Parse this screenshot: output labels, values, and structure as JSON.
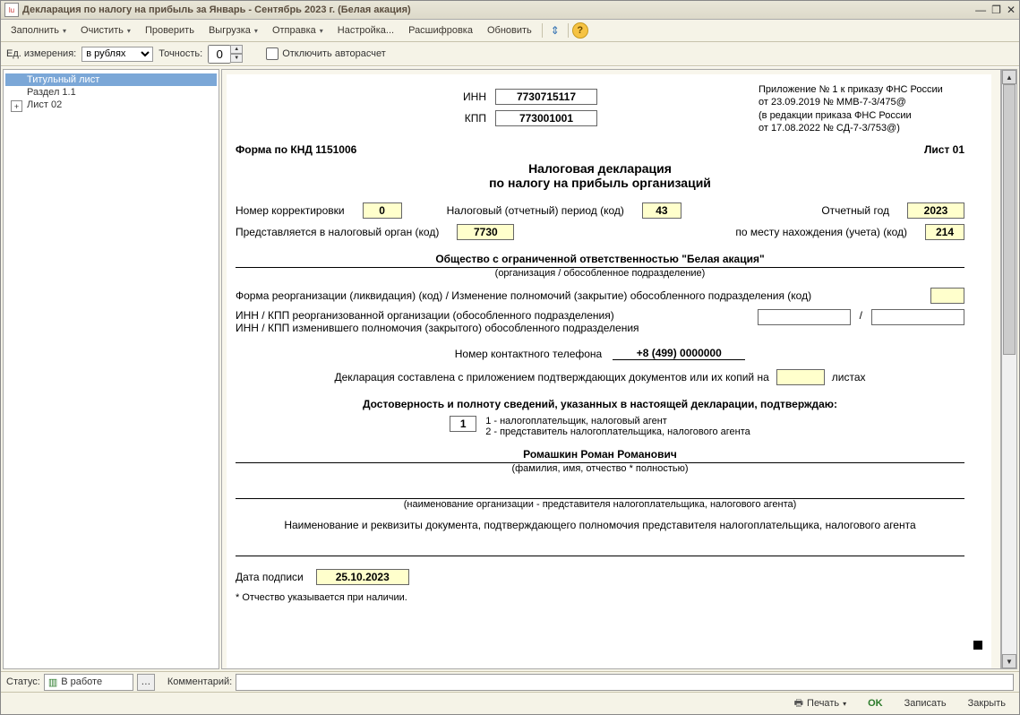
{
  "window": {
    "title": "Декларация по налогу на прибыль за Январь - Сентябрь 2023 г. (Белая акация)"
  },
  "toolbar": {
    "fill": "Заполнить",
    "clear": "Очистить",
    "check": "Проверить",
    "export": "Выгрузка",
    "send": "Отправка",
    "settings": "Настройка...",
    "decode": "Расшифровка",
    "refresh": "Обновить"
  },
  "sub": {
    "units_label": "Ед. измерения:",
    "units_value": "в рублях",
    "precision_label": "Точность:",
    "precision_value": "0",
    "autocalc": "Отключить авторасчет"
  },
  "tree": {
    "n0": "Титульный лист",
    "n1": "Раздел 1.1",
    "n2": "Лист 02"
  },
  "doc": {
    "inn_label": "ИНН",
    "inn": "7730715117",
    "kpp_label": "КПП",
    "kpp": "773001001",
    "appx1": "Приложение № 1 к приказу ФНС России",
    "appx2": "от 23.09.2019 № ММВ-7-3/475@",
    "appx3": "(в редакции приказа ФНС России",
    "appx4": "от 17.08.2022 № СД-7-3/753@)",
    "form_knd": "Форма по КНД 1151006",
    "sheet": "Лист 01",
    "title1": "Налоговая декларация",
    "title2": "по налогу на прибыль организаций",
    "corr_label": "Номер корректировки",
    "corr": "0",
    "period_label": "Налоговый (отчетный) период (код)",
    "period": "43",
    "year_label": "Отчетный год",
    "year": "2023",
    "organ_label": "Представляется в налоговый орган (код)",
    "organ": "7730",
    "place_label": "по месту нахождения (учета) (код)",
    "place": "214",
    "org_name": "Общество с ограниченной ответственностью \"Белая акация\"",
    "org_sub": "(организация / обособленное подразделение)",
    "reorg_label": "Форма реорганизации (ликвидация) (код) / Изменение полномочий (закрытие) обособленного подразделения (код)",
    "reorg_inn1": "ИНН / КПП реорганизованной организации (обособленного подразделения)",
    "reorg_inn2": "ИНН / КПП изменившего полномочия (закрытого) обособленного подразделения",
    "sep": "/",
    "phone_label": "Номер контактного телефона",
    "phone": "+8 (499) 0000000",
    "attach_label1": "Декларация составлена с приложением подтверждающих документов или их копий на",
    "attach_label2": "листах",
    "confirm_title": "Достоверность и полноту сведений, указанных в настоящей декларации, подтверждаю:",
    "confirm_code": "1",
    "confirm_opt1": "1 - налогоплательщик, налоговый агент",
    "confirm_opt2": "2 - представитель налогоплательщика, налогового агента",
    "fio": "Ромашкин Роман Романович",
    "fio_sub": "(фамилия, имя, отчество *  полностью)",
    "repr_sub": "(наименование организации - представителя налогоплательщика, налогового агента)",
    "doc_auth": "Наименование и реквизиты документа, подтверждающего полномочия представителя налогоплательщика, налогового агента",
    "sign_date_label": "Дата подписи",
    "sign_date": "25.10.2023",
    "note": "* Отчество указывается при наличии."
  },
  "status": {
    "label": "Статус:",
    "value": "В работе",
    "comment_label": "Комментарий:"
  },
  "footer": {
    "print": "Печать",
    "ok": "OK",
    "save": "Записать",
    "close": "Закрыть"
  }
}
